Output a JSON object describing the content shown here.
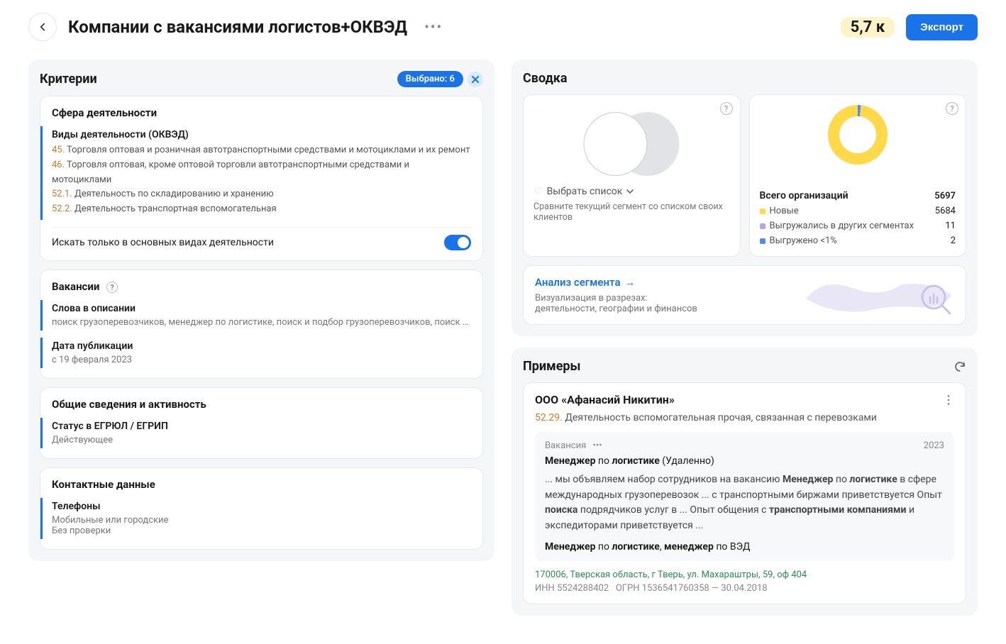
{
  "header": {
    "title": "Компании с вакансиями логистов+ОКВЭД",
    "count": "5,7 к",
    "export": "Экспорт"
  },
  "criteria": {
    "title": "Критерии",
    "selected_label": "Выбрано: 6",
    "activity": {
      "card_title": "Сфера деятельности",
      "block_title": "Виды деятельности (ОКВЭД)",
      "lines": [
        {
          "code": "45.",
          "text": "Торговля оптовая и розничная автотранспортными средствами и мотоциклами и их ремонт"
        },
        {
          "code": "46.",
          "text": "Торговля оптовая, кроме оптовой торговли автотранспортными средствами и мотоциклами"
        },
        {
          "code": "52.1.",
          "text": "Деятельность по складированию и хранению"
        },
        {
          "code": "52.2.",
          "text": "Деятельность транспортная вспомогательная"
        }
      ],
      "toggle_label": "Искать только в основных видах деятельности"
    },
    "vacancies": {
      "card_title": "Вакансии",
      "words_title": "Слова в описании",
      "words_text": "поиск грузоперевозчиков, менеджер по логистике, поиск и подбор грузоперевозчиков, поиск транспо...",
      "date_title": "Дата публикации",
      "date_text": "с 19 февраля 2023"
    },
    "general": {
      "card_title": "Общие сведения и активность",
      "status_title": "Статус в ЕГРЮЛ / ЕГРИП",
      "status_text": "Действующее"
    },
    "contacts": {
      "card_title": "Контактные данные",
      "phones_title": "Телефоны",
      "phones_line1": "Мобильные или городские",
      "phones_line2": "Без проверки"
    }
  },
  "summary": {
    "title": "Сводка",
    "compare": {
      "select_label": "Выбрать список",
      "note": "Сравните текущий сегмент со списком своих клиентов"
    },
    "totals": {
      "label": "Всего организаций",
      "value": "5697",
      "rows": [
        {
          "color": "dot-yellow",
          "label": "Новые",
          "value": "5684"
        },
        {
          "color": "dot-purple",
          "label": "Выгружались в других сегментах",
          "value": "11"
        },
        {
          "color": "dot-blue",
          "label": "Выгружено <1%",
          "value": "2"
        }
      ]
    },
    "analysis": {
      "link": "Анализ сегмента",
      "sub1": "Визуализация в разрезах:",
      "sub2": "деятельности, географии и финансов"
    }
  },
  "examples": {
    "title": "Примеры",
    "company": {
      "name": "ООО «Афанасий Никитин»",
      "okved_code": "52.29.",
      "okved_text": "Деятельность вспомогательная прочая, связанная с перевозками",
      "vacancy": {
        "label": "Вакансия",
        "year": "2023",
        "title_pre": "Менеджер",
        "title_mid": " по ",
        "title_bold2": "логистике",
        "title_tail": " (Удаленно)",
        "desc": "... мы объявляем набор сотрудников на вакансию <b>Менеджер</b> по <b>логистике</b> в сфере международных грузоперевозок ... с транспортными биржами приветствуется Опыт <b>поиска</b> подрядчиков услуг в ... Опыт общения с <b>транспортными компаниями</b> и экспедиторами приветствуется ...",
        "tags": "<b>Менеджер</b> по <b>логистике</b>, <b>менеджер</b> по ВЭД"
      },
      "address": "170006, Тверская область, г Тверь, ул. Махараштры, 59, оф 404",
      "inn_label": "ИНН",
      "inn": "5524288402",
      "ogrn_label": "ОГРН",
      "ogrn": "1536541760358",
      "date": "30.04.2018"
    }
  }
}
